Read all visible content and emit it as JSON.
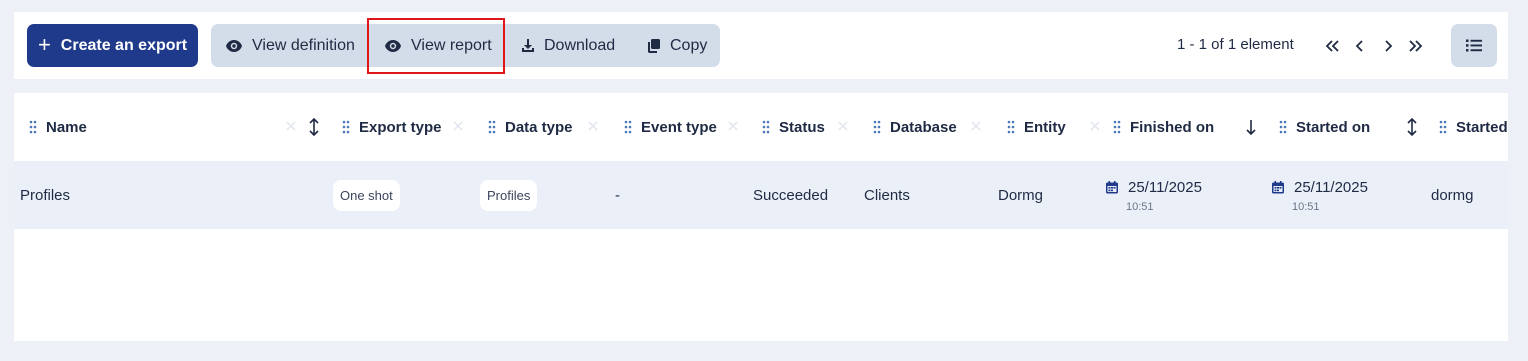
{
  "toolbar": {
    "create_label": "Create an export",
    "view_definition_label": "View definition",
    "view_report_label": "View report",
    "download_label": "Download",
    "copy_label": "Copy",
    "pagination_text": "1 - 1 of 1 element",
    "highlight_color": "#e0161b",
    "accent_color": "#1f3a8a"
  },
  "table": {
    "columns": [
      {
        "label": "Name",
        "sort": "both"
      },
      {
        "label": "Export type"
      },
      {
        "label": "Data type"
      },
      {
        "label": "Event type"
      },
      {
        "label": "Status"
      },
      {
        "label": "Database"
      },
      {
        "label": "Entity"
      },
      {
        "label": "Finished on",
        "sort": "desc"
      },
      {
        "label": "Started on",
        "sort": "both"
      },
      {
        "label": "Started"
      }
    ],
    "rows": [
      {
        "name": "Profiles",
        "export_type": "One shot",
        "data_type": "Profiles",
        "event_type": "-",
        "status": "Succeeded",
        "database": "Clients",
        "entity": "Dormg",
        "finished_date": "25/11/2025",
        "finished_time": "10:51",
        "started_date": "25/11/2025",
        "started_time": "10:51",
        "started_by": "dormg"
      }
    ]
  },
  "icons": {
    "create": "plus-icon",
    "view": "eye-icon",
    "download": "download-icon",
    "copy": "copy-icon",
    "first": "double-chevron-left-icon",
    "prev": "chevron-left-icon",
    "next": "chevron-right-icon",
    "last": "double-chevron-right-icon",
    "list_view": "list-icon",
    "drag": "drag-handle-icon",
    "calendar": "calendar-icon"
  }
}
